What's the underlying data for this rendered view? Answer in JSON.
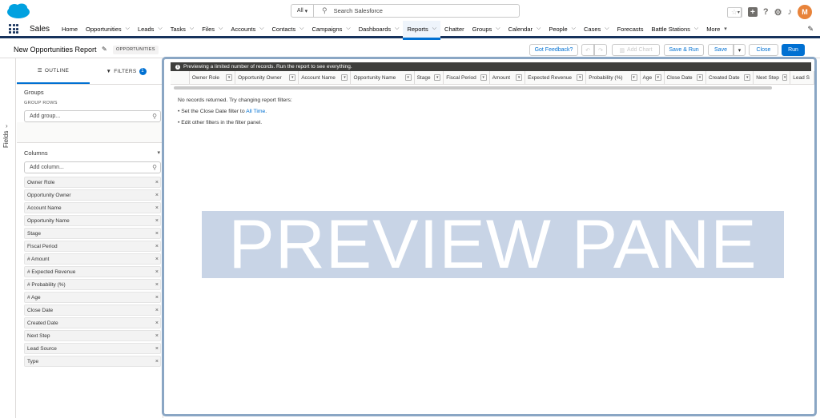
{
  "global": {
    "search_scope": "All",
    "search_placeholder": "Search Salesforce",
    "avatar_initial": "M"
  },
  "nav": {
    "app_name": "Sales",
    "items": [
      {
        "label": "Home",
        "has_menu": false
      },
      {
        "label": "Opportunities",
        "has_menu": true
      },
      {
        "label": "Leads",
        "has_menu": true
      },
      {
        "label": "Tasks",
        "has_menu": true
      },
      {
        "label": "Files",
        "has_menu": true
      },
      {
        "label": "Accounts",
        "has_menu": true
      },
      {
        "label": "Contacts",
        "has_menu": true
      },
      {
        "label": "Campaigns",
        "has_menu": true
      },
      {
        "label": "Dashboards",
        "has_menu": true
      },
      {
        "label": "Reports",
        "has_menu": true,
        "active": true
      },
      {
        "label": "Chatter",
        "has_menu": false
      },
      {
        "label": "Groups",
        "has_menu": true
      },
      {
        "label": "Calendar",
        "has_menu": true
      },
      {
        "label": "People",
        "has_menu": true
      },
      {
        "label": "Cases",
        "has_menu": true
      },
      {
        "label": "Forecasts",
        "has_menu": false
      },
      {
        "label": "Battle Stations",
        "has_menu": true
      },
      {
        "label": "More",
        "has_menu": true
      }
    ]
  },
  "report": {
    "title": "New Opportunities Report",
    "type_badge": "OPPORTUNITIES",
    "buttons": {
      "feedback": "Got Feedback?",
      "add_chart": "Add Chart",
      "save_run": "Save & Run",
      "save": "Save",
      "close": "Close",
      "run": "Run"
    }
  },
  "side": {
    "fields_label": "Fields",
    "tab_outline": "OUTLINE",
    "tab_filters": "FILTERS",
    "filters_count": "1",
    "groups_title": "Groups",
    "group_rows_label": "GROUP ROWS",
    "add_group_placeholder": "Add group...",
    "columns_title": "Columns",
    "add_column_placeholder": "Add column...",
    "columns": [
      "Owner Role",
      "Opportunity Owner",
      "Account Name",
      "Opportunity Name",
      "Stage",
      "Fiscal Period",
      "# Amount",
      "# Expected Revenue",
      "# Probability (%)",
      "# Age",
      "Close Date",
      "Created Date",
      "Next Step",
      "Lead Source",
      "Type"
    ]
  },
  "preview": {
    "banner": "Previewing a limited number of records. Run the report to see everything.",
    "headers": [
      "Owner Role",
      "Opportunity Owner",
      "Account Name",
      "Opportunity Name",
      "Stage",
      "Fiscal Period",
      "Amount",
      "Expected Revenue",
      "Probability (%)",
      "Age",
      "Close Date",
      "Created Date",
      "Next Step",
      "Lead S"
    ],
    "no_records": "No records returned. Try changing report filters:",
    "hint1_prefix": "• Set the Close Date filter to ",
    "hint1_link": "All Time",
    "hint1_suffix": ".",
    "hint2": "• Edit other filters in the filter panel.",
    "watermark": "PREVIEW PANE"
  }
}
